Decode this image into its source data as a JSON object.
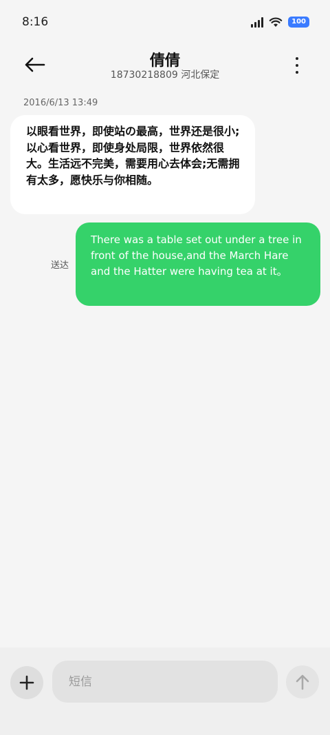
{
  "status_bar": {
    "time": "8:16",
    "battery": "100",
    "icons": [
      "signal-icon",
      "wifi-icon",
      "battery-icon"
    ],
    "battery_color": "#3a7bff"
  },
  "header": {
    "contact_name": "倩倩",
    "contact_sub": "18730218809 河北保定",
    "icons": [
      "back-arrow-icon",
      "more-vertical-icon"
    ]
  },
  "conversation": {
    "timestamp": "2016/6/13 13:49",
    "incoming_message": "以眼看世界，即使站の最高，世界还是很小;以心看世界，即使身处局限，世界依然很大。生活远不完美，需要用心去体会;无需拥有太多，愿快乐与你相随。",
    "delivered_label": "送达",
    "outgoing_message": "There was a table set out under a tree in front of the house,and the March Hare and the Hatter were having tea at it。",
    "outgoing_bubble_color": "#35d26a"
  },
  "composer": {
    "placeholder": "短信",
    "icons": [
      "plus-icon",
      "send-arrow-icon"
    ]
  }
}
